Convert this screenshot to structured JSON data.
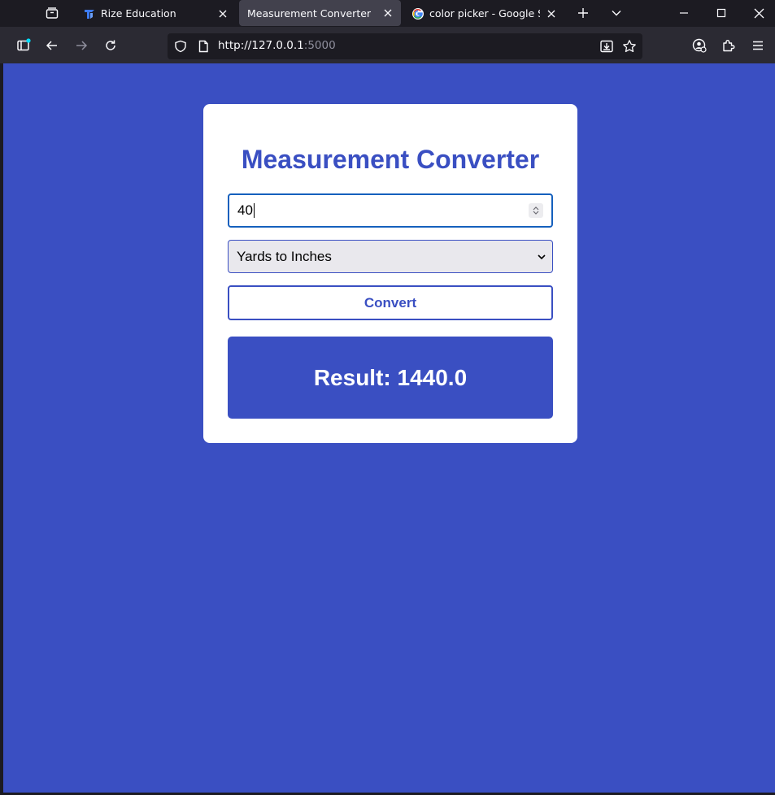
{
  "browser": {
    "tabs": [
      {
        "title": "Rize Education",
        "favicon": "rize-logo-icon",
        "active": false
      },
      {
        "title": "Measurement Converter",
        "favicon": "none",
        "active": true
      },
      {
        "title": "color picker - Google Search",
        "favicon": "google-g-icon",
        "active": false
      }
    ],
    "url": {
      "host": "http://127.0.0.1",
      "port": ":5000"
    }
  },
  "page": {
    "heading": "Measurement Converter",
    "input_value": "40",
    "select_value": "Yards to Inches",
    "convert_label": "Convert",
    "result_text": "Result: 1440.0"
  },
  "colors": {
    "page_bg": "#3a4fc2",
    "accent": "#3a4fc2",
    "card_bg": "#ffffff",
    "chrome_dark": "#1c1b22",
    "chrome_toolbar": "#2b2a33"
  }
}
